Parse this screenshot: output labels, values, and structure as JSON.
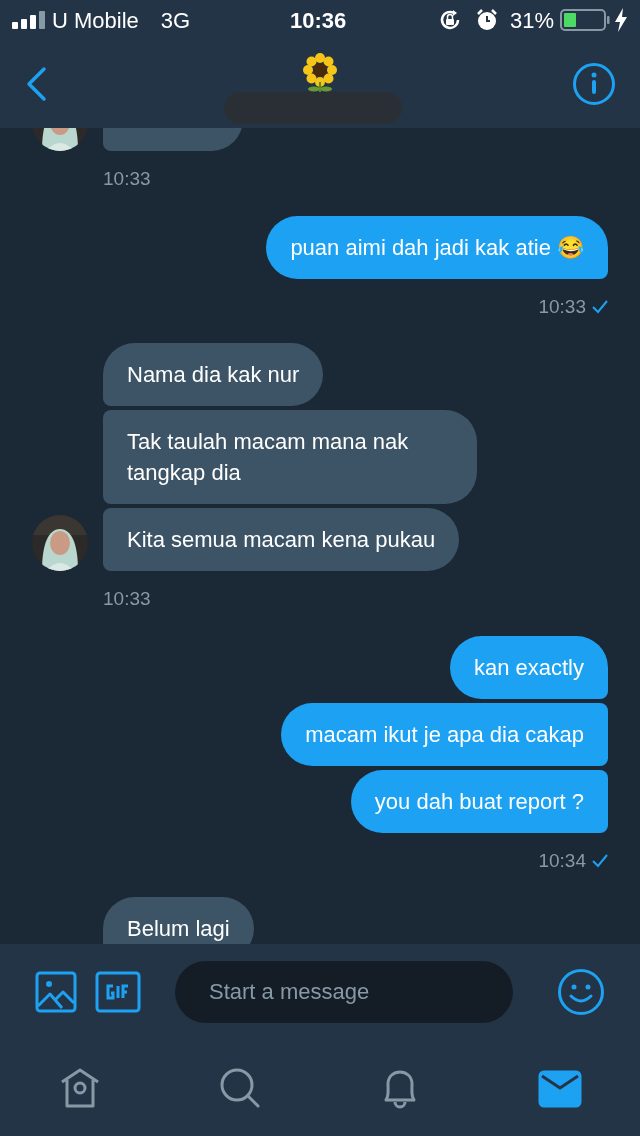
{
  "status_bar": {
    "carrier": "U Mobile",
    "network": "3G",
    "time": "10:36",
    "battery": "31%"
  },
  "messages": [
    {
      "kind": "incoming",
      "time": "10:33"
    },
    {
      "kind": "outgoing",
      "bubbles": [
        "puan aimi dah jadi kak atie 😂"
      ],
      "time": "10:33",
      "delivered": true
    },
    {
      "kind": "incoming",
      "bubbles": [
        "Nama dia kak nur",
        "Tak taulah macam mana nak tangkap dia",
        "Kita semua macam kena pukau"
      ],
      "time": "10:33"
    },
    {
      "kind": "outgoing",
      "bubbles": [
        "kan exactly",
        "macam ikut je apa dia cakap",
        "you dah buat report ?"
      ],
      "time": "10:34",
      "delivered": true
    },
    {
      "kind": "incoming",
      "bubbles": [
        "Belum lagi"
      ]
    }
  ],
  "composer": {
    "placeholder": "Start a message"
  },
  "tabs": [
    {
      "kind": "home",
      "selected": false
    },
    {
      "kind": "search",
      "selected": false
    },
    {
      "kind": "notifications",
      "selected": false
    },
    {
      "kind": "messages",
      "selected": true
    }
  ]
}
